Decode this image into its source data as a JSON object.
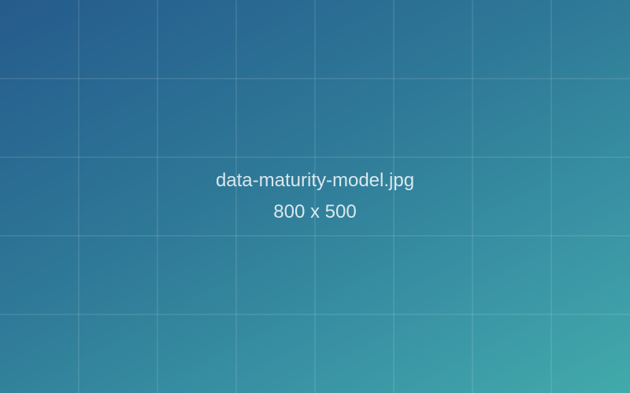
{
  "image": {
    "filename": "data-maturity-model.jpg",
    "dimensions_label": "800 x 500"
  },
  "colors": {
    "gradient_start": "#255b8c",
    "gradient_end": "#42aaab",
    "text": "#e6eef3",
    "grid_line": "#ffffff"
  }
}
